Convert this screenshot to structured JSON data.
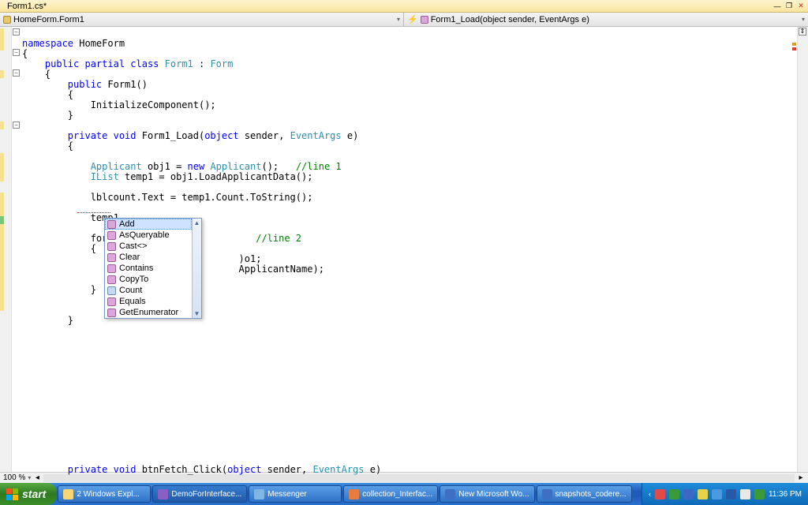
{
  "tab": {
    "title": "Form1.cs*"
  },
  "nav": {
    "class": "HomeForm.Form1",
    "member": "Form1_Load(object sender, EventArgs e)"
  },
  "code": {
    "l1a": "namespace",
    "l1b": " HomeForm",
    "l2": "{",
    "l3a": "    public partial class ",
    "l3b": "Form1",
    "l3c": " : ",
    "l3d": "Form",
    "l4": "    {",
    "l5a": "        public",
    "l5b": " Form1()",
    "l6": "        {",
    "l7": "            InitializeComponent();",
    "l8": "        }",
    "l9": "",
    "l10a": "        private void",
    "l10b": " Form1_Load(",
    "l10c": "object",
    "l10d": " sender, ",
    "l10e": "EventArgs",
    "l10f": " e)",
    "l11": "        {",
    "l12": "",
    "l13a": "            ",
    "l13b": "Applicant",
    "l13c": " obj1 = ",
    "l13d": "new ",
    "l13e": "Applicant",
    "l13f": "();   ",
    "l13g": "//line 1",
    "l14a": "            ",
    "l14b": "IList",
    "l14c": " temp1 = obj1.LoadApplicantData();",
    "l15": "",
    "l16": "            lblcount.Text = temp1.Count.ToString();",
    "l17": "",
    "l18": "            temp1.",
    "l19": "",
    "l20a": "            foreac",
    "l20b": "                       ",
    "l20c": "//line 2",
    "l21": "            {",
    "l22a": "                Ap",
    "l22b": "                    ",
    "l22c": ")o1;",
    "l23a": "                ls",
    "l23b": "                    ",
    "l23c": "ApplicantName);",
    "l24": "",
    "l25": "            }",
    "l26": "",
    "l27": "",
    "l28": "        }",
    "l29": ""
  },
  "truncated": {
    "a": "        private void",
    "b": " btnFetch_Click(",
    "c": "object",
    "d": " sender, ",
    "e": "EventArgs",
    "f": " e)"
  },
  "intellisense": {
    "items": [
      "Add",
      "AsQueryable",
      "Cast<>",
      "Clear",
      "Contains",
      "CopyTo",
      "Count",
      "Equals",
      "GetEnumerator"
    ],
    "selected": 0
  },
  "zoom": "100 %",
  "taskbar": {
    "start": "start",
    "items": [
      {
        "label": "2 Windows Expl...",
        "icon": "#f5d776"
      },
      {
        "label": "DemoForInterface...",
        "icon": "#8a5fc4",
        "active": true
      },
      {
        "label": "Messenger",
        "icon": "#7fb6e6"
      },
      {
        "label": "collection_Interfac...",
        "icon": "#e77c3f"
      },
      {
        "label": "New Microsoft Wo...",
        "icon": "#3d6fc4"
      },
      {
        "label": "snapshots_codere...",
        "icon": "#3d6fc4"
      }
    ],
    "tray_icons": [
      "#e04a4a",
      "#3a9a3a",
      "#3a68c4",
      "#e8d24a",
      "#4a9ae0",
      "#2a58a8",
      "#e8e8e8",
      "#3a9a3a"
    ],
    "time": "11:36 PM"
  }
}
